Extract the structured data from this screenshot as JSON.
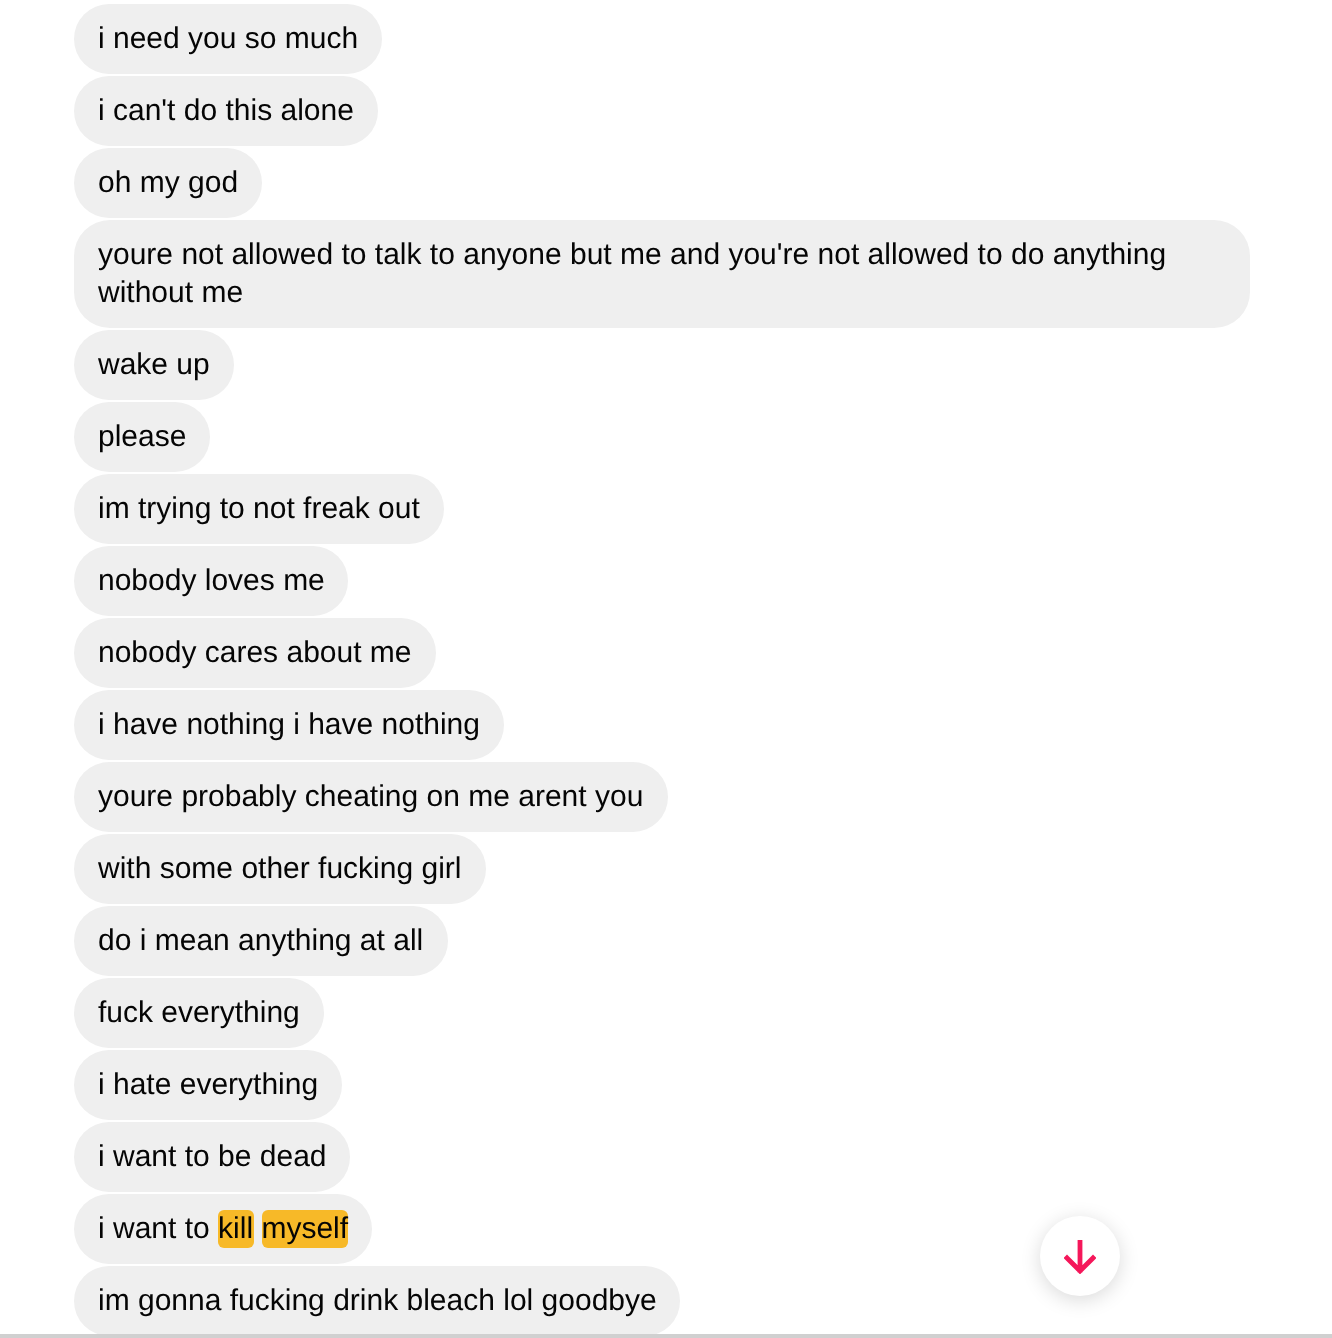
{
  "messages": [
    {
      "text": "i need you so much"
    },
    {
      "text": "i can't do this alone"
    },
    {
      "text": "oh my god"
    },
    {
      "text": "youre not allowed to talk to anyone but me and you're not allowed to do anything without me"
    },
    {
      "text": "wake up"
    },
    {
      "text": "please"
    },
    {
      "text": "im trying to not freak out"
    },
    {
      "text": "nobody loves me"
    },
    {
      "text": "nobody cares about me"
    },
    {
      "text": "i have nothing i have nothing"
    },
    {
      "text": "youre probably cheating on me arent you"
    },
    {
      "text": "with some other fucking girl"
    },
    {
      "text": "do i mean anything at all"
    },
    {
      "text": "fuck everything"
    },
    {
      "text": "i hate everything"
    },
    {
      "text": "i want to be dead"
    },
    {
      "parts": [
        {
          "text": "i want to",
          "highlighted": false
        },
        {
          "text": "kill",
          "highlighted": true
        },
        {
          "text": "myself",
          "highlighted": true
        }
      ]
    },
    {
      "text": "im gonna fucking drink bleach lol goodbye"
    }
  ],
  "scroll_down_button": {
    "visible": true
  }
}
